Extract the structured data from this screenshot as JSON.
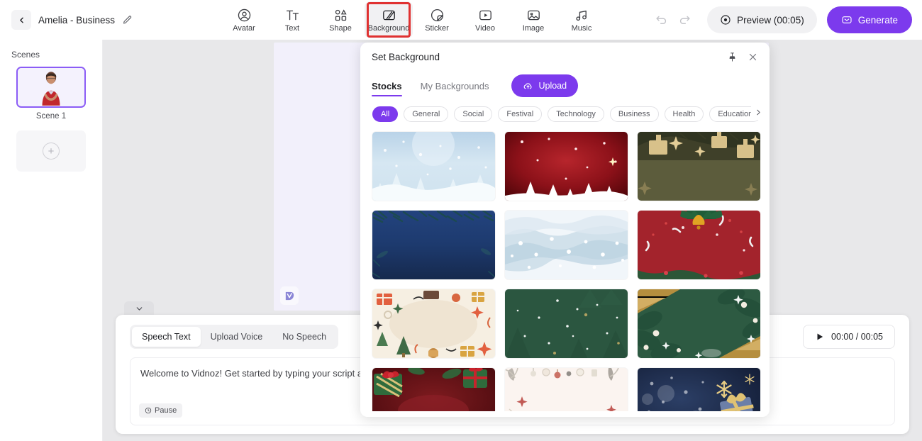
{
  "header": {
    "back_icon": "chevron-left-icon",
    "project_title": "Amelia - Business",
    "edit_icon": "pencil-edit-icon",
    "tools": [
      {
        "label": "Avatar",
        "icon": "avatar-icon",
        "active": false
      },
      {
        "label": "Text",
        "icon": "text-icon",
        "active": false
      },
      {
        "label": "Shape",
        "icon": "shape-icon",
        "active": false
      },
      {
        "label": "Background",
        "icon": "background-icon",
        "active": true
      },
      {
        "label": "Sticker",
        "icon": "sticker-icon",
        "active": false
      },
      {
        "label": "Video",
        "icon": "video-icon",
        "active": false
      },
      {
        "label": "Image",
        "icon": "image-icon",
        "active": false
      },
      {
        "label": "Music",
        "icon": "music-icon",
        "active": false
      }
    ],
    "undo_icon": "undo-icon",
    "redo_icon": "redo-icon",
    "preview_label": "Preview (00:05)",
    "preview_icon": "play-circle-icon",
    "generate_label": "Generate",
    "generate_icon": "generate-icon",
    "accent_color": "#7c3aed",
    "highlight_color": "#e03131"
  },
  "sidebar": {
    "title": "Scenes",
    "scenes": [
      {
        "label": "Scene 1",
        "selected": true
      }
    ],
    "add_scene_icon": "plus-circle-icon"
  },
  "canvas": {
    "watermark_icon": "vidnoz-logo-icon",
    "collapse_icon": "chevron-down-icon"
  },
  "script_panel": {
    "tabs": [
      {
        "label": "Speech Text",
        "selected": true
      },
      {
        "label": "Upload Voice",
        "selected": false
      },
      {
        "label": "No Speech",
        "selected": false
      }
    ],
    "time_display": "00:00 / 00:05",
    "play_icon": "play-icon",
    "script_text": "Welcome to Vidnoz! Get started by typing your script and ge",
    "pause_chip_label": "Pause",
    "pause_chip_icon": "clock-icon"
  },
  "background_panel": {
    "title": "Set Background",
    "pin_icon": "pin-icon",
    "close_icon": "close-icon",
    "tabs": [
      {
        "label": "Stocks",
        "selected": true
      },
      {
        "label": "My Backgrounds",
        "selected": false
      }
    ],
    "upload_label": "Upload",
    "upload_icon": "upload-cloud-icon",
    "categories": [
      {
        "label": "All",
        "selected": true
      },
      {
        "label": "General",
        "selected": false
      },
      {
        "label": "Social",
        "selected": false
      },
      {
        "label": "Festival",
        "selected": false
      },
      {
        "label": "Technology",
        "selected": false
      },
      {
        "label": "Business",
        "selected": false
      },
      {
        "label": "Health",
        "selected": false
      },
      {
        "label": "Education",
        "selected": false
      }
    ],
    "categories_next_icon": "chevron-right-icon",
    "thumbnails": [
      {
        "name": "winter-snow-trees-blue",
        "style": "snow-blue"
      },
      {
        "name": "red-christmas-night-trees",
        "style": "red-night"
      },
      {
        "name": "olive-gold-gifts-frame",
        "style": "olive-gold"
      },
      {
        "name": "navy-pine-border",
        "style": "navy-pine"
      },
      {
        "name": "pale-blue-watercolor-snow",
        "style": "pale-watercolor"
      },
      {
        "name": "red-bell-garland",
        "style": "red-bell"
      },
      {
        "name": "cream-festive-doodle-frame",
        "style": "cream-doodle"
      },
      {
        "name": "dark-green-snowfall",
        "style": "green-snow"
      },
      {
        "name": "green-foliage-gold-corners",
        "style": "green-gold"
      },
      {
        "name": "dark-red-gift-ribbons",
        "style": "red-gift"
      },
      {
        "name": "ivory-ornament-border",
        "style": "ivory-ornament"
      },
      {
        "name": "navy-snowflake-gift",
        "style": "navy-gift"
      }
    ]
  }
}
